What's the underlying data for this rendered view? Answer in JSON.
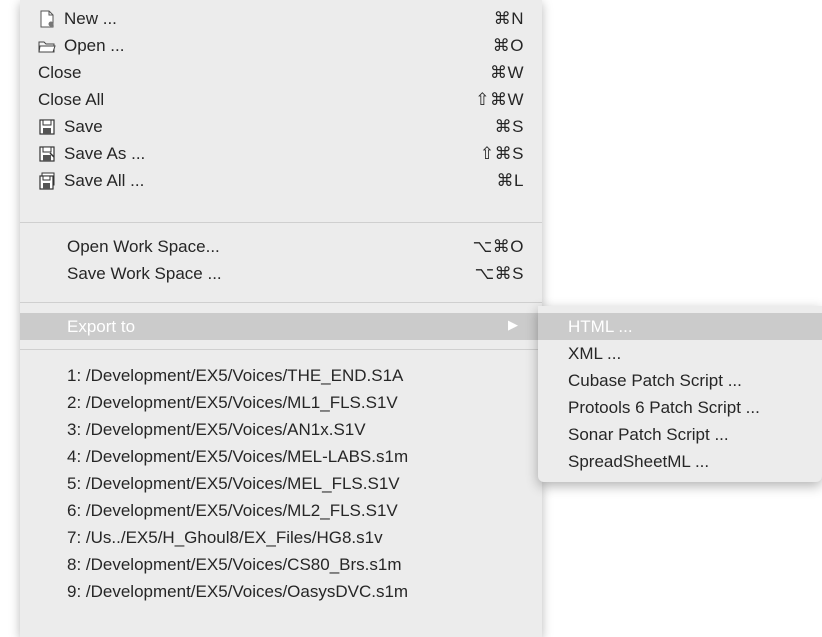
{
  "menu": {
    "file_items": [
      {
        "icon": "new-document-icon",
        "label": "New ...",
        "shortcut": "⌘N"
      },
      {
        "icon": "open-folder-icon",
        "label": "Open ...",
        "shortcut": "⌘O"
      },
      {
        "label": "Close",
        "shortcut": "⌘W"
      },
      {
        "label": "Close All",
        "shortcut": "⇧⌘W"
      },
      {
        "icon": "save-icon",
        "label": "Save",
        "shortcut": "⌘S"
      },
      {
        "icon": "save-as-icon",
        "label": "Save As ...",
        "shortcut": "⇧⌘S"
      },
      {
        "icon": "save-all-icon",
        "label": "Save All ...",
        "shortcut": "⌘L"
      }
    ],
    "workspace_items": [
      {
        "label": "Open Work Space...",
        "shortcut": "⌥⌘O"
      },
      {
        "label": "Save Work Space ...",
        "shortcut": "⌥⌘S"
      }
    ],
    "export_item": {
      "label": "Export to",
      "arrow": "▶"
    },
    "recent_files": [
      "1: /Development/EX5/Voices/THE_END.S1A",
      "2: /Development/EX5/Voices/ML1_FLS.S1V",
      "3: /Development/EX5/Voices/AN1x.S1V",
      "4: /Development/EX5/Voices/MEL-LABS.s1m",
      "5: /Development/EX5/Voices/MEL_FLS.S1V",
      "6: /Development/EX5/Voices/ML2_FLS.S1V",
      "7: /Us../EX5/H_Ghoul8/EX_Files/HG8.s1v",
      "8: /Development/EX5/Voices/CS80_Brs.s1m",
      "9: /Development/EX5/Voices/OasysDVC.s1m"
    ]
  },
  "submenu": {
    "items": [
      "HTML ...",
      "XML ...",
      "Cubase Patch Script ...",
      "Protools 6 Patch Script ...",
      "Sonar Patch Script ...",
      "SpreadSheetML ..."
    ],
    "highlighted_index": 0
  },
  "colors": {
    "menu_background": "#ececec",
    "highlight": "#cbcbcb",
    "highlight_text": "#ffffff",
    "text": "#262626"
  }
}
